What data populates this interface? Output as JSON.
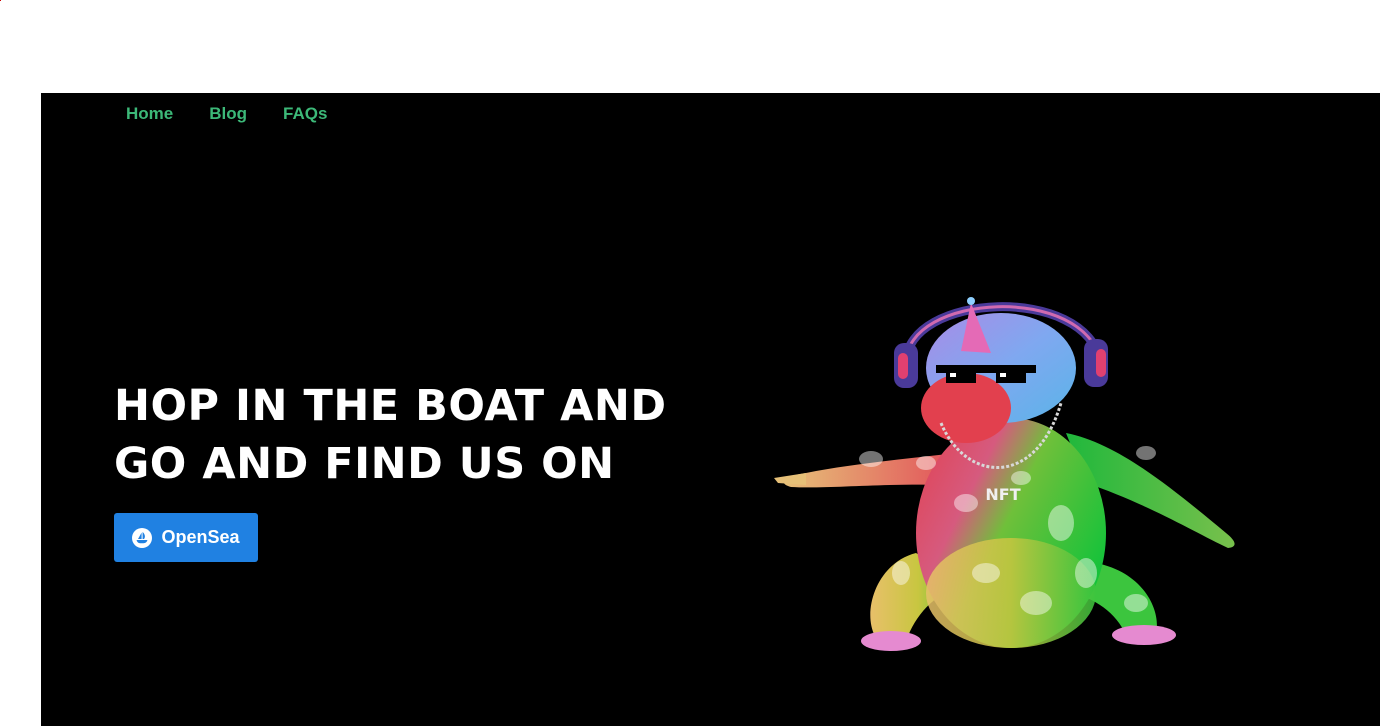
{
  "nav": {
    "items": [
      {
        "label": "Home"
      },
      {
        "label": "Blog"
      },
      {
        "label": "FAQs"
      }
    ]
  },
  "hero": {
    "title_line1": "HOP IN THE BOAT AND",
    "title_line2": "GO AND FIND US ON",
    "cta_label": "OpenSea"
  },
  "colors": {
    "nav_link": "#3cb878",
    "cta_background": "#2081e2",
    "background": "#000000"
  },
  "illustration": {
    "necklace_text": "NFT",
    "icon": "frog-dj-illustration"
  }
}
